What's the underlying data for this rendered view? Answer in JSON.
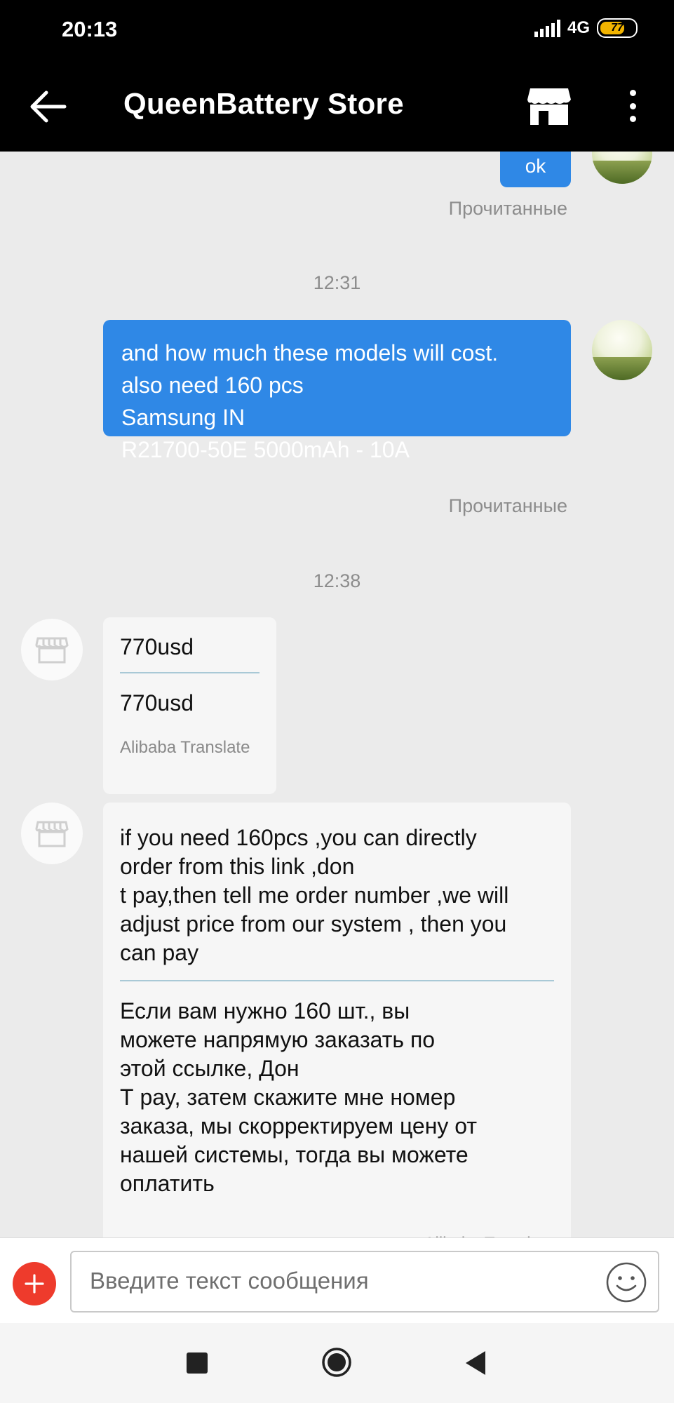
{
  "status_bar": {
    "time": "20:13",
    "network": "4G",
    "battery_percent": "77",
    "battery_level": 0.77
  },
  "header": {
    "title": "QueenBattery Store",
    "icons": [
      "arrow-left-icon",
      "store-icon",
      "more-vertical-icon"
    ]
  },
  "chat": {
    "messages": [
      {
        "direction": "outgoing",
        "text": "ok",
        "status": "Прочитанные"
      },
      {
        "time": "12:31"
      },
      {
        "direction": "outgoing",
        "lines": [
          "and how much these models will cost.",
          "also need 160 pcs",
          "Samsung IN",
          "R21700-50E 5000mAh - 10A"
        ],
        "status": "Прочитанные"
      },
      {
        "time": "12:38"
      },
      {
        "direction": "incoming",
        "original": "770usd",
        "translation": "770usd",
        "translator": "Alibaba Translate"
      },
      {
        "direction": "incoming",
        "original_lines": [
          "if you need 160pcs ,you can directly",
          "order from this link ,don",
          "t pay,then tell me order number ,we will",
          "adjust price from our system , then you",
          "can pay"
        ],
        "translation_lines": [
          "Если вам нужно 160 шт., вы",
          "можете напрямую заказать по",
          "этой ссылке, Дон",
          "Т pay, затем скажите мне номер",
          "заказа, мы скорректируем цену от",
          "нашей системы, тогда вы можете",
          "оплатить"
        ],
        "translator": "Alibaba Translate"
      }
    ]
  },
  "input": {
    "placeholder": "Введите текст сообщения",
    "value": ""
  },
  "colors": {
    "accent_blue": "#2f88e6",
    "plus_red": "#ee3b2c",
    "chat_bg": "#ebebeb",
    "header_bg": "#000000"
  }
}
